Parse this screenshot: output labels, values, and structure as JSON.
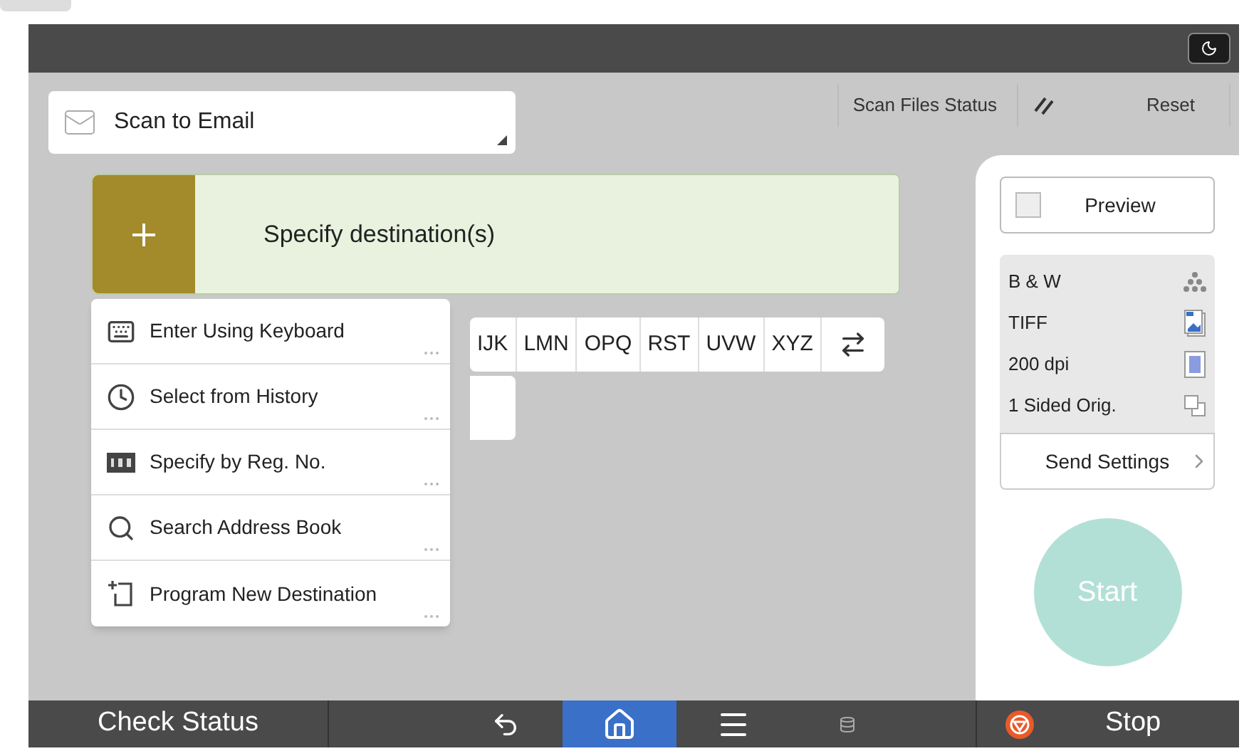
{
  "function_selector": {
    "label": "Scan to Email"
  },
  "header": {
    "scan_files_status": "Scan Files Status",
    "reset": "Reset"
  },
  "destination": {
    "label": "Specify destination(s)"
  },
  "index_tabs": [
    "IJK",
    "LMN",
    "OPQ",
    "RST",
    "UVW",
    "XYZ"
  ],
  "menu": [
    {
      "label": "Enter Using Keyboard",
      "kind": "keyboard"
    },
    {
      "label": "Select from History",
      "kind": "history"
    },
    {
      "label": "Specify by Reg. No.",
      "kind": "number"
    },
    {
      "label": "Search Address Book",
      "kind": "search"
    },
    {
      "label": "Program New Destination",
      "kind": "new"
    }
  ],
  "preview": {
    "label": "Preview",
    "checked": false
  },
  "settings": [
    {
      "label": "B & W",
      "kind": "color"
    },
    {
      "label": "TIFF",
      "kind": "file"
    },
    {
      "label": "200 dpi",
      "kind": "resolution"
    },
    {
      "label": "1 Sided Orig.",
      "kind": "sides"
    }
  ],
  "send_settings": "Send Settings",
  "start": {
    "label": "Start",
    "disabled": true
  },
  "bottom_bar": {
    "check_status": "Check Status",
    "nav": [
      {
        "kind": "back",
        "selected": false
      },
      {
        "kind": "home",
        "selected": true
      },
      {
        "kind": "menu",
        "selected": false
      },
      {
        "kind": "storage",
        "selected": false
      }
    ],
    "stop": "Stop"
  }
}
